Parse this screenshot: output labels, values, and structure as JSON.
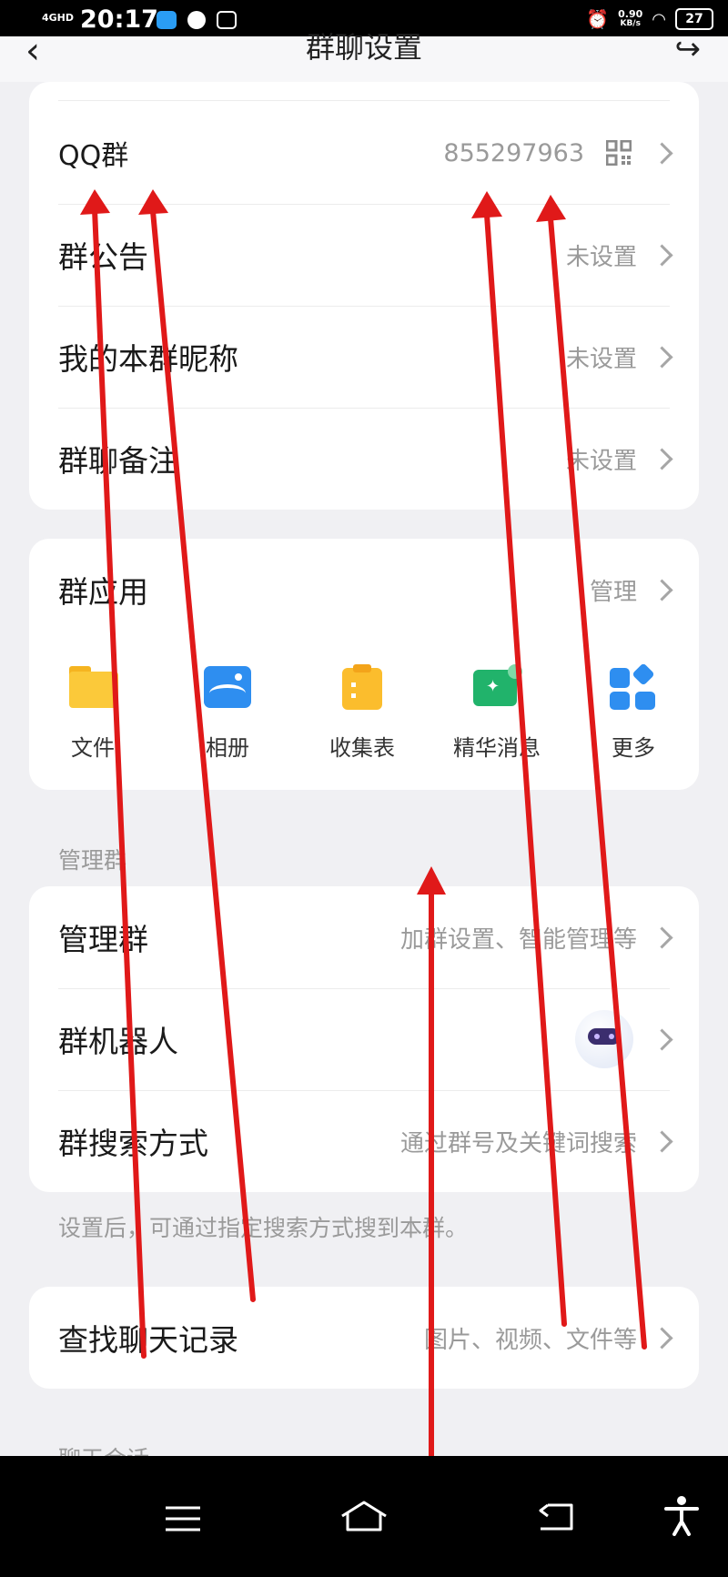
{
  "status_bar": {
    "network": "4GHD",
    "time": "20:17",
    "speed_value": "0.90",
    "speed_unit": "KB/s",
    "battery": "27"
  },
  "header": {
    "title": "群聊设置"
  },
  "group_info": {
    "rows": [
      {
        "label": "QQ群",
        "value": "855297963"
      },
      {
        "label": "群公告",
        "value": "未设置"
      },
      {
        "label": "我的本群昵称",
        "value": "未设置"
      },
      {
        "label": "群聊备注",
        "value": "未设置"
      }
    ]
  },
  "group_apps": {
    "title": "群应用",
    "action": "管理",
    "apps": [
      {
        "label": "文件",
        "icon": "folder-icon"
      },
      {
        "label": "相册",
        "icon": "photo-album-icon"
      },
      {
        "label": "收集表",
        "icon": "clipboard-icon"
      },
      {
        "label": "精华消息",
        "icon": "highlight-message-icon"
      },
      {
        "label": "更多",
        "icon": "more-grid-icon"
      }
    ]
  },
  "manage_section": {
    "section_title": "管理群",
    "rows": [
      {
        "label": "管理群",
        "value": "加群设置、智能管理等"
      },
      {
        "label": "群机器人",
        "value": ""
      },
      {
        "label": "群搜索方式",
        "value": "通过群号及关键词搜索"
      }
    ],
    "footnote": "设置后，可通过指定搜索方式搜到本群。"
  },
  "chat_history": {
    "label": "查找聊天记录",
    "value": "图片、视频、文件等"
  },
  "next_section_title": "聊天会话",
  "colors": {
    "background": "#f0f0f3",
    "card": "#ffffff",
    "arrow": "#e01919",
    "secondary_text": "#9a9a9a"
  }
}
